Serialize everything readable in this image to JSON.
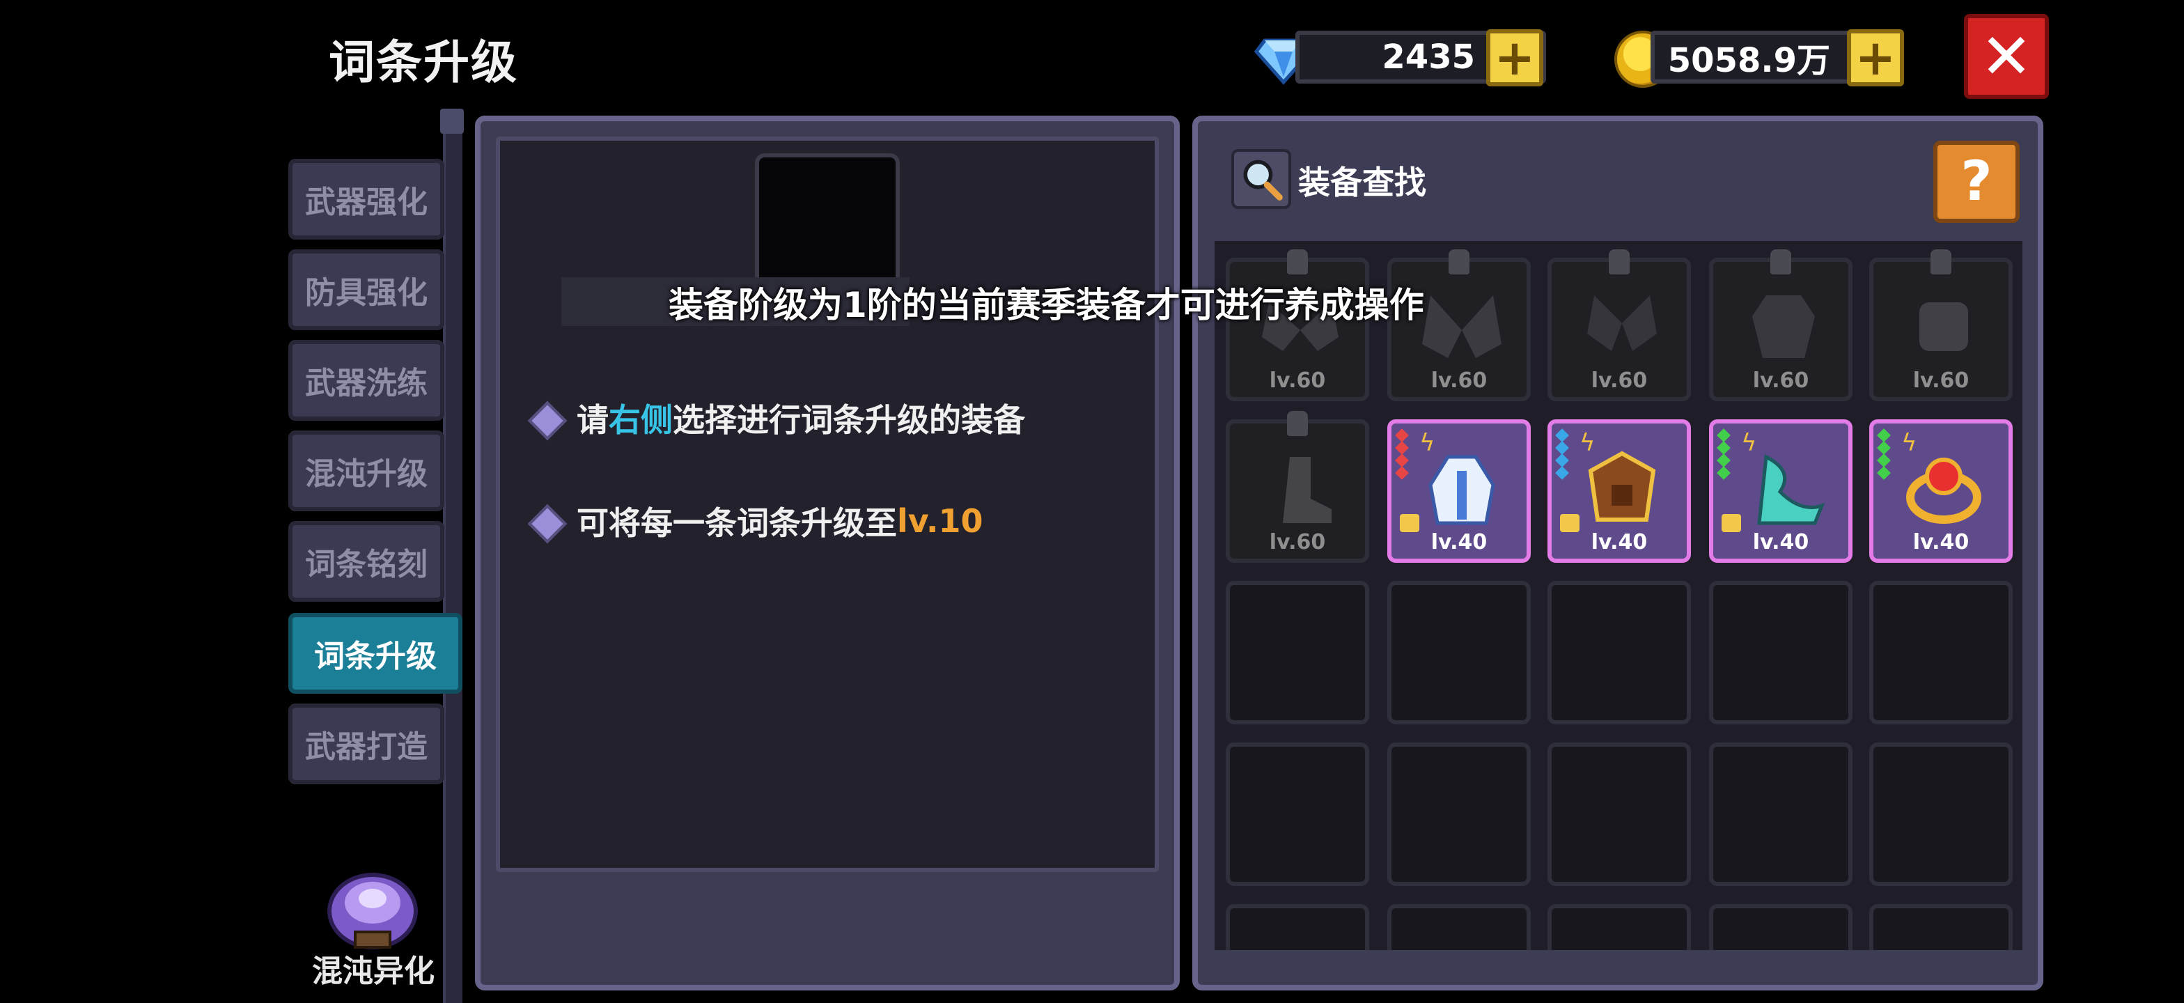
{
  "header": {
    "title": "词条升级",
    "gems": "2435",
    "gold": "5058.9万",
    "plus_label": "+",
    "close_label": "✕"
  },
  "sidebar": {
    "tabs": [
      {
        "label": "武器强化",
        "active": false
      },
      {
        "label": "防具强化",
        "active": false
      },
      {
        "label": "武器洗练",
        "active": false
      },
      {
        "label": "混沌升级",
        "active": false
      },
      {
        "label": "词条铭刻",
        "active": false
      },
      {
        "label": "词条升级",
        "active": true
      },
      {
        "label": "武器打造",
        "active": false
      }
    ],
    "special": {
      "label": "混沌异化"
    }
  },
  "left_panel": {
    "line1": {
      "prefix": "请",
      "highlight": "右侧",
      "suffix": "选择进行词条升级的装备"
    },
    "line2": {
      "prefix": "可将每一条词条升级至",
      "highlight": "lv.10"
    }
  },
  "overlay_message": "装备阶级为1阶的当前赛季装备才可进行养成操作",
  "right_panel": {
    "search_label": "装备查找",
    "help_label": "?",
    "items_row1": [
      {
        "level": "lv.60",
        "art": "wings-icon"
      },
      {
        "level": "lv.60",
        "art": "wings-icon"
      },
      {
        "level": "lv.60",
        "art": "wings-icon"
      },
      {
        "level": "lv.60",
        "art": "armor-icon"
      },
      {
        "level": "lv.60",
        "art": "gauntlet-icon"
      }
    ],
    "items_row2": [
      {
        "level": "lv.60",
        "art": "boots-icon",
        "style": "gray"
      },
      {
        "level": "lv.40",
        "art": "robe-icon",
        "style": "purple",
        "gem_color": "#e84545"
      },
      {
        "level": "lv.40",
        "art": "chest-armor-icon",
        "style": "purple",
        "gem_color": "#3aa7e8"
      },
      {
        "level": "lv.40",
        "art": "shoes-icon",
        "style": "purple",
        "gem_color": "#42d04a"
      },
      {
        "level": "lv.40",
        "art": "ring-icon",
        "style": "purple",
        "gem_color": "#42d04a"
      }
    ]
  },
  "colors": {
    "active_tab": "#1b7f98",
    "highlight_blue": "#38c4e6",
    "highlight_orange": "#f0a030",
    "purple_border": "#e47ce8",
    "close_red": "#d52222",
    "plus_yellow": "#f3d245"
  }
}
